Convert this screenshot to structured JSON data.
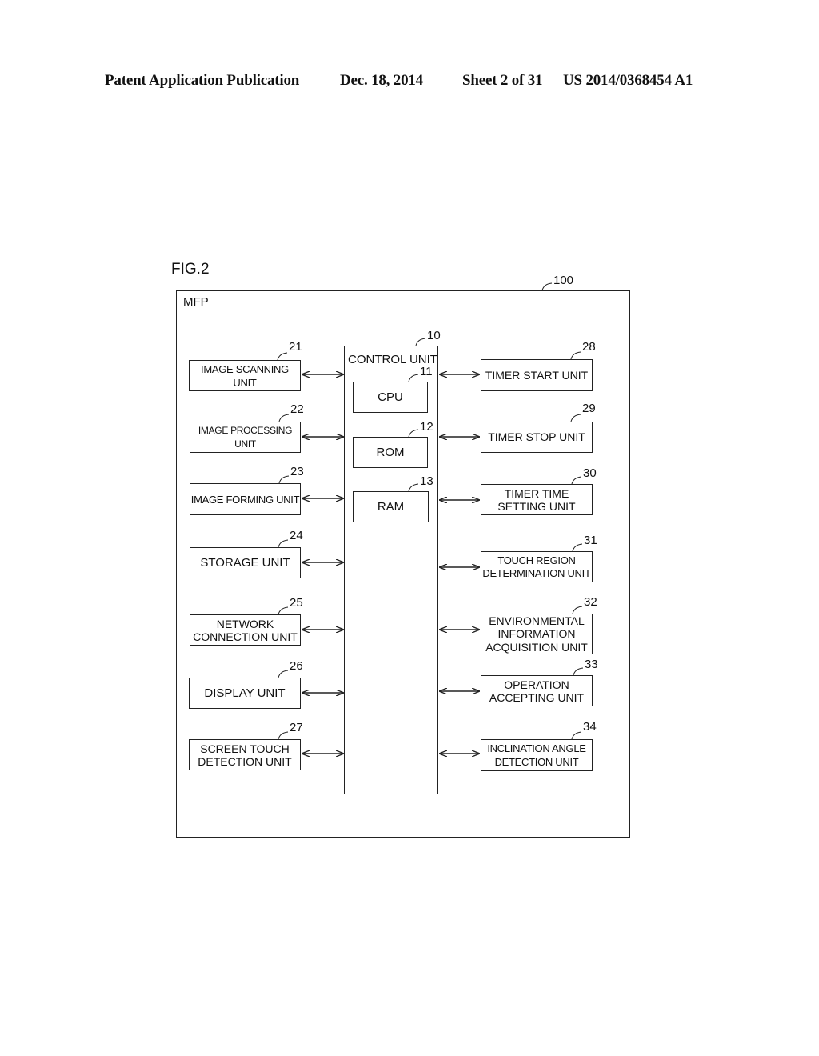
{
  "header": {
    "publication": "Patent Application Publication",
    "date": "Dec. 18, 2014",
    "sheet": "Sheet 2 of 31",
    "number": "US 2014/0368454 A1"
  },
  "figure": {
    "label": "FIG.2",
    "outer": {
      "label": "MFP",
      "ref": "100"
    },
    "control": {
      "label": "CONTROL UNIT",
      "ref": "10"
    },
    "inner": [
      {
        "label": "CPU",
        "ref": "11"
      },
      {
        "label": "ROM",
        "ref": "12"
      },
      {
        "label": "RAM",
        "ref": "13"
      }
    ],
    "left_units": [
      {
        "label": "IMAGE SCANNING UNIT",
        "ref": "21"
      },
      {
        "label": "IMAGE PROCESSING UNIT",
        "ref": "22"
      },
      {
        "label": "IMAGE FORMING UNIT",
        "ref": "23"
      },
      {
        "label": "STORAGE UNIT",
        "ref": "24"
      },
      {
        "label": "NETWORK\nCONNECTION UNIT",
        "ref": "25"
      },
      {
        "label": "DISPLAY UNIT",
        "ref": "26"
      },
      {
        "label": "SCREEN TOUCH\nDETECTION UNIT",
        "ref": "27"
      }
    ],
    "right_units": [
      {
        "label": "TIMER START UNIT",
        "ref": "28"
      },
      {
        "label": "TIMER STOP UNIT",
        "ref": "29"
      },
      {
        "label": "TIMER TIME\nSETTING UNIT",
        "ref": "30"
      },
      {
        "label": "TOUCH REGION\nDETERMINATION UNIT",
        "ref": "31"
      },
      {
        "label": "ENVIRONMENTAL\nINFORMATION\nACQUISITION UNIT",
        "ref": "32"
      },
      {
        "label": "OPERATION\nACCEPTING UNIT",
        "ref": "33"
      },
      {
        "label": "INCLINATION ANGLE\nDETECTION UNIT",
        "ref": "34"
      }
    ],
    "connection": "bidirectional"
  }
}
